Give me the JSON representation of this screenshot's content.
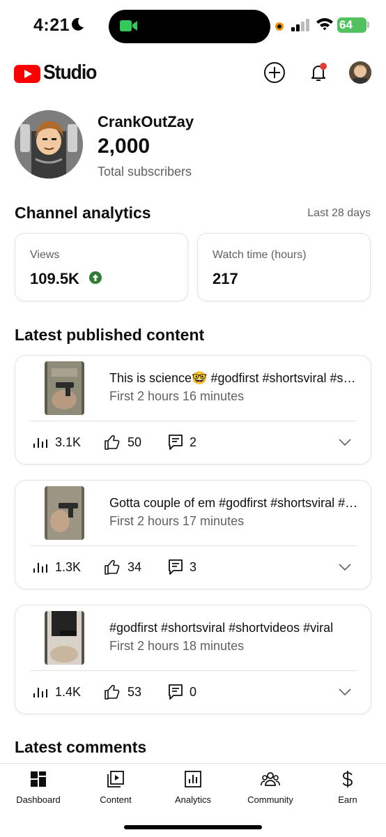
{
  "status_bar": {
    "time": "4:21",
    "battery": "64"
  },
  "header": {
    "brand": "Studio"
  },
  "channel": {
    "name": "CrankOutZay",
    "subscribers": "2,000",
    "subscribers_label": "Total subscribers"
  },
  "analytics": {
    "title": "Channel analytics",
    "period": "Last 28 days",
    "views_label": "Views",
    "views_value": "109.5K",
    "watch_label": "Watch time (hours)",
    "watch_value": "217"
  },
  "latest": {
    "title": "Latest published content",
    "items": [
      {
        "title": "This is science🤓 #godfirst #shortsviral #shortvideos",
        "time": "First 2 hours 16 minutes",
        "views": "3.1K",
        "likes": "50",
        "comments": "2"
      },
      {
        "title": "Gotta couple of em #godfirst #shortsviral #shortvideos",
        "time": "First 2 hours 17 minutes",
        "views": "1.3K",
        "likes": "34",
        "comments": "3"
      },
      {
        "title": "#godfirst #shortsviral #shortvideos #viral",
        "time": "First 2 hours 18 minutes",
        "views": "1.4K",
        "likes": "53",
        "comments": "0"
      }
    ]
  },
  "comments": {
    "title": "Latest comments"
  },
  "nav": {
    "dashboard": "Dashboard",
    "content": "Content",
    "analytics": "Analytics",
    "community": "Community",
    "earn": "Earn"
  },
  "colors": {
    "brand_red": "#ff0000",
    "trend_green": "#2e7d32",
    "notify_red": "#e53935",
    "battery_green": "#52c15f"
  },
  "icons": [
    "moon-icon",
    "facetime-icon",
    "signal-icon",
    "wifi-icon",
    "youtube-logo",
    "create-icon",
    "bell-icon",
    "up-arrow-icon",
    "views-icon",
    "like-icon",
    "comment-icon",
    "chevron-down-icon",
    "dashboard-icon",
    "content-icon",
    "analytics-icon",
    "community-icon",
    "earn-icon"
  ]
}
